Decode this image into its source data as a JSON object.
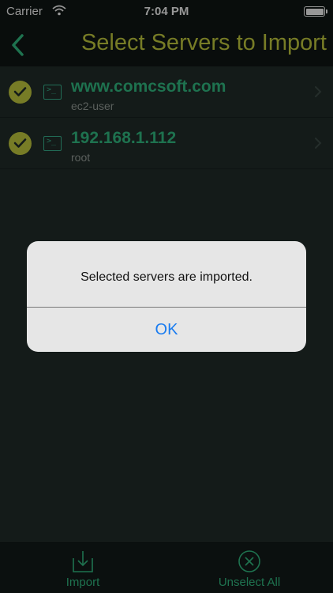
{
  "status_bar": {
    "carrier": "Carrier",
    "time": "7:04 PM"
  },
  "nav": {
    "title": "Select Servers to Import",
    "back_icon": "chevron-left-icon"
  },
  "servers": [
    {
      "host": "www.comcsoft.com",
      "user": "ec2-user",
      "selected": true
    },
    {
      "host": "192.168.1.112",
      "user": "root",
      "selected": true
    }
  ],
  "tab_bar": {
    "import_label": "Import",
    "unselect_label": "Unselect All"
  },
  "alert": {
    "message": "Selected servers are imported.",
    "ok_label": "OK"
  },
  "colors": {
    "accent_yellow": "#b7bf3b",
    "accent_green": "#2fb07a",
    "alert_button_blue": "#1a7cf0"
  }
}
